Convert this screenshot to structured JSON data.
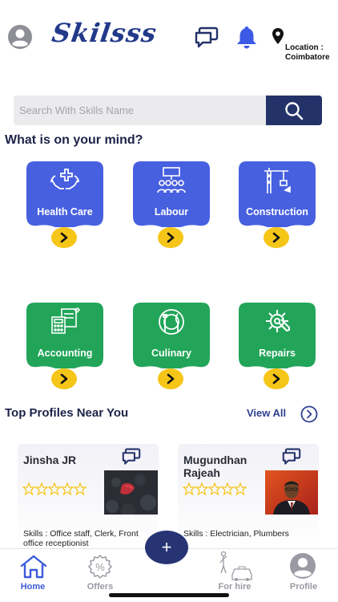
{
  "header": {
    "app_name": "Skilsss",
    "location_label": "Location :",
    "location_value": "Coimbatore",
    "icons": [
      "user-avatar-icon",
      "chat-icon",
      "bell-icon",
      "location-pin-icon"
    ]
  },
  "search": {
    "placeholder": "Search With Skills Name",
    "value": ""
  },
  "categories_title": "What is on your mind?",
  "categories": [
    {
      "label": "Health Care",
      "icon": "healthcare-hands-icon",
      "color": "#4760e0"
    },
    {
      "label": "Labour",
      "icon": "labour-workers-icon",
      "color": "#4760e0"
    },
    {
      "label": "Construction",
      "icon": "construction-crane-icon",
      "color": "#4760e0"
    },
    {
      "label": "Accounting",
      "icon": "accounting-calculator-icon",
      "color": "#22a559"
    },
    {
      "label": "Culinary",
      "icon": "culinary-plate-icon",
      "color": "#22a559"
    },
    {
      "label": "Repairs",
      "icon": "repairs-gear-wrench-icon",
      "color": "#22a559"
    }
  ],
  "top_profiles": {
    "title": "Top Profiles Near You",
    "view_all": "View All",
    "profiles": [
      {
        "name": "Jinsha JR",
        "rating": 0,
        "skills": "Skills :  Office staff, Clerk, Front office receptionist"
      },
      {
        "name": "Mugundhan Rajeah",
        "rating": 0,
        "skills": "Skills :  Electrician, Plumbers"
      }
    ]
  },
  "bottom_nav": {
    "items": [
      {
        "label": "Home",
        "icon": "home-icon",
        "active": true
      },
      {
        "label": "Offers",
        "icon": "offers-percent-icon",
        "active": false
      },
      {
        "label": "For hire",
        "icon": "for-hire-icon",
        "active": false
      },
      {
        "label": "Profile",
        "icon": "profile-icon",
        "active": false
      }
    ],
    "fab_label": "+"
  },
  "colors": {
    "accent_blue": "#4760e0",
    "accent_green": "#22a559",
    "navy": "#233269",
    "yellow": "#f5c518"
  }
}
